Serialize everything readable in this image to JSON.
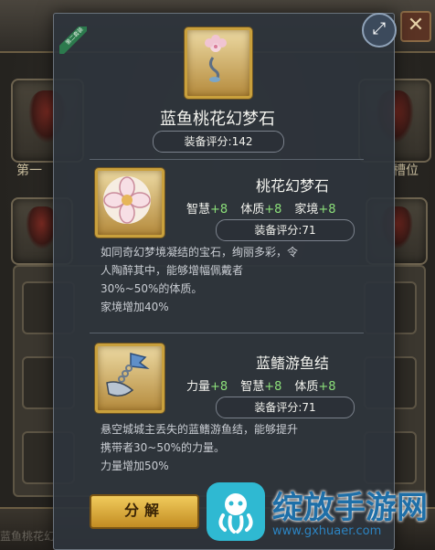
{
  "background": {
    "slot_label_left": "第一",
    "slot_label_right": "槽位",
    "close_glyph": "✕",
    "bottom_text": "蓝鱼桃花幻"
  },
  "tooltip": {
    "badge": "第二套装",
    "expand_icon": "expand-arrows-icon",
    "main": {
      "name": "蓝鱼桃花幻梦石",
      "score_label": "装备评分:",
      "score_value": "142"
    },
    "items": [
      {
        "name": "桃花幻梦石",
        "stats": [
          {
            "label": "智慧",
            "value": "+8"
          },
          {
            "label": "体质",
            "value": "+8"
          },
          {
            "label": "家境",
            "value": "+8"
          }
        ],
        "score_label": "装备评分:",
        "score_value": "71",
        "desc_lines": [
          "如同奇幻梦境凝结的宝石，绚丽多彩，令",
          "人陶醉其中，能够增幅佩戴者",
          "30%~50%的体质。",
          "家境增加40%"
        ]
      },
      {
        "name": "蓝鳍游鱼结",
        "stats": [
          {
            "label": "力量",
            "value": "+8"
          },
          {
            "label": "智慧",
            "value": "+8"
          },
          {
            "label": "体质",
            "value": "+8"
          }
        ],
        "score_label": "装备评分:",
        "score_value": "71",
        "desc_lines": [
          "悬空城城主丢失的蓝鳍游鱼结，能够提升",
          "携带者30~50%的力量。",
          "力量增加50%"
        ]
      }
    ],
    "decompose_label": "分解"
  },
  "watermark": {
    "text": "绽放手游网",
    "url": "www.gxhuaer.com"
  },
  "colors": {
    "stat_value": "#8ce07a",
    "gold_frame": "#c9a03c",
    "tooltip_bg": "#2e343c"
  }
}
